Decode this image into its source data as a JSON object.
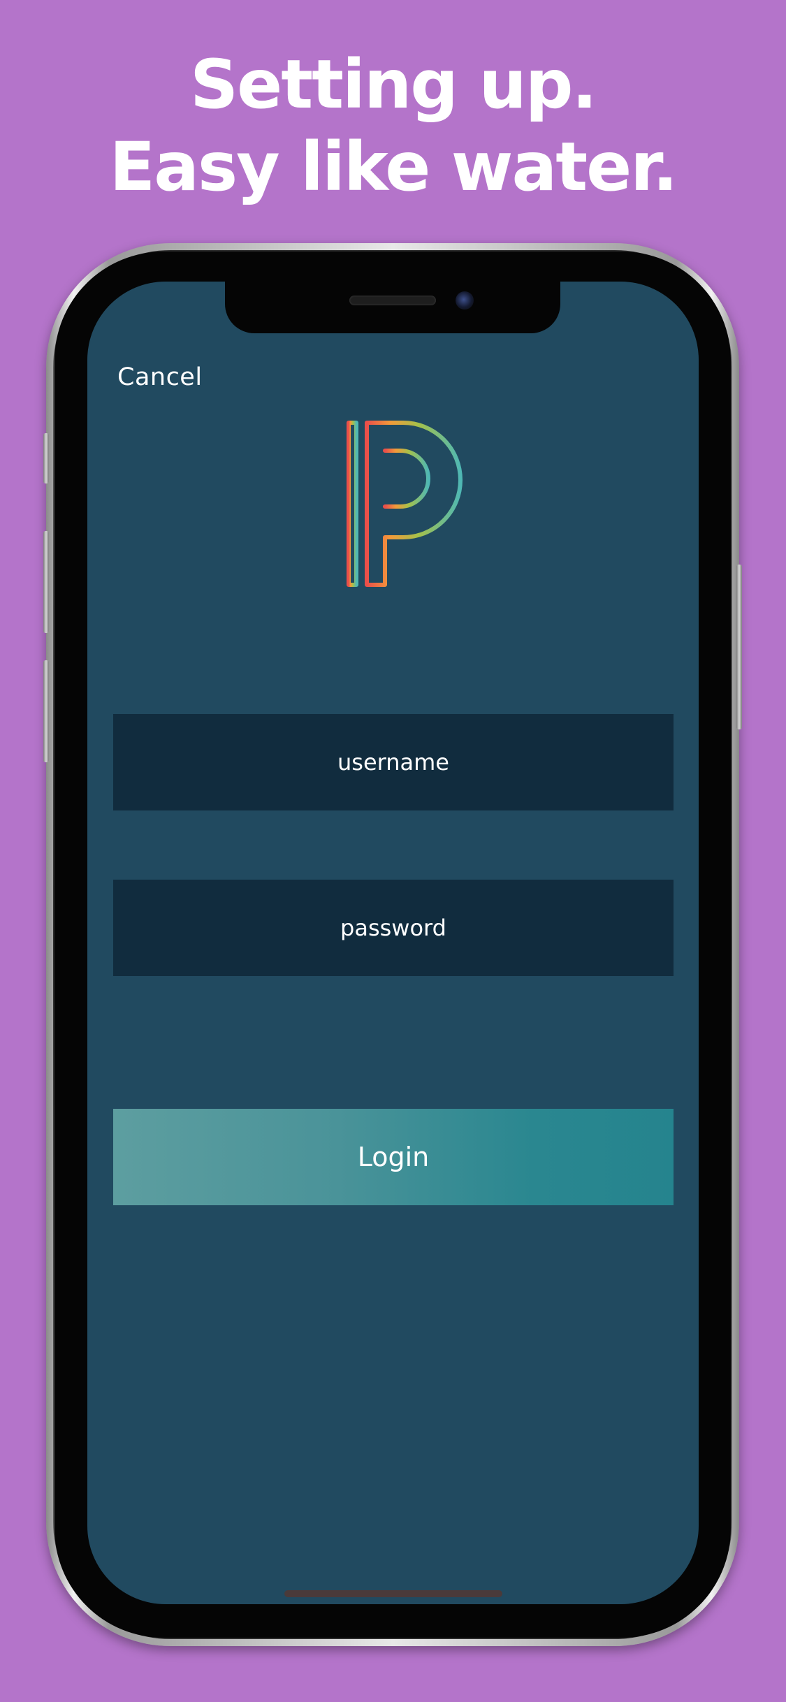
{
  "headline": {
    "line1": "Setting up.",
    "line2": "Easy like water."
  },
  "colors": {
    "background": "#b474ca",
    "screen": "#214a60",
    "field": "#112c3e",
    "login_gradient_start": "#5d9ea0",
    "login_gradient_end": "#25848e"
  },
  "screen": {
    "cancel_label": "Cancel",
    "logo_icon": "powerschool-p-logo-icon",
    "username_placeholder": "username",
    "password_placeholder": "password",
    "login_label": "Login"
  }
}
